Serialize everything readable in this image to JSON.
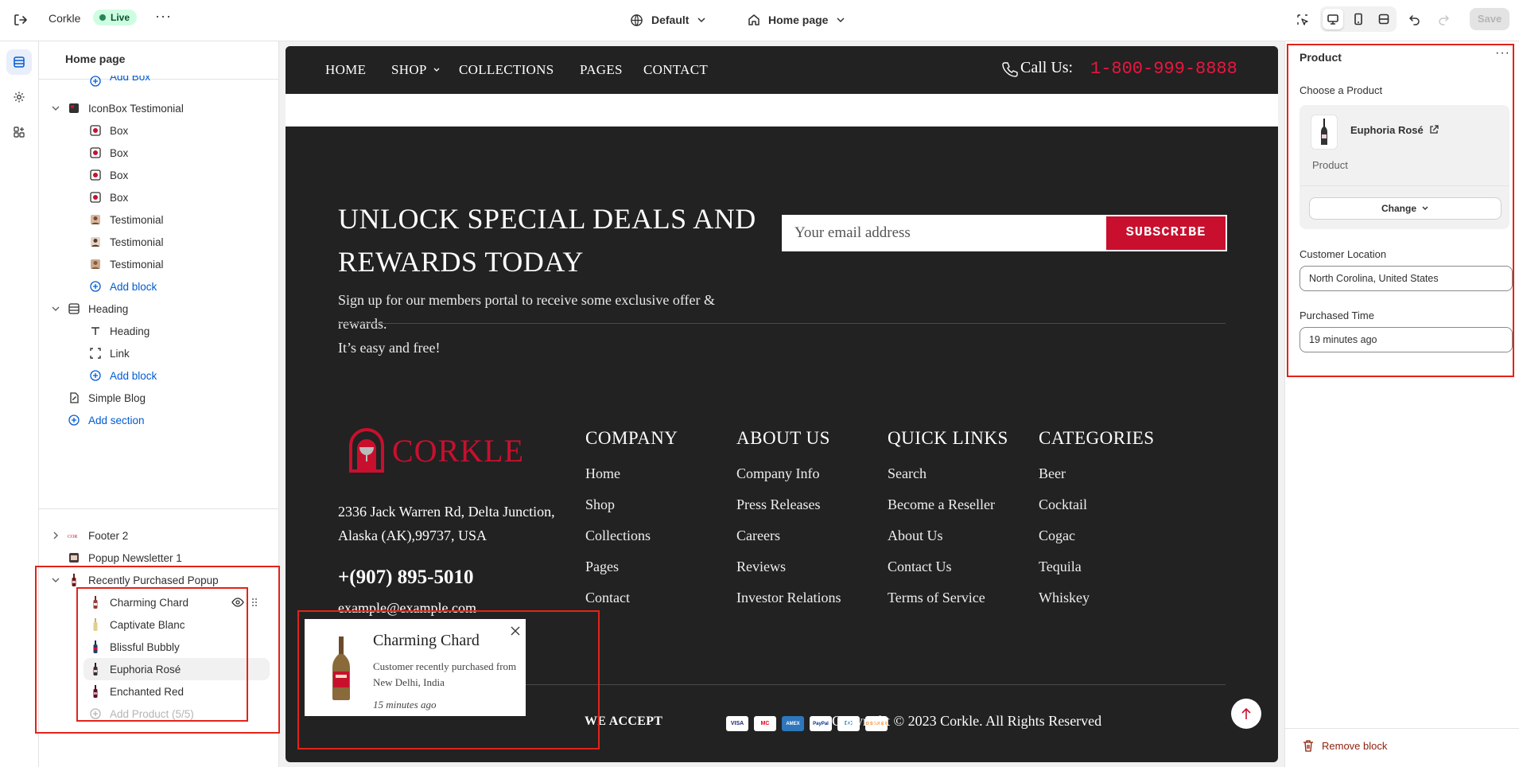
{
  "topbar": {
    "store_name": "Corkle",
    "status": "Live",
    "theme": "Default",
    "page": "Home page",
    "save_label": "Save"
  },
  "sidebar": {
    "title": "Home page",
    "items": [
      {
        "label": "Add Box",
        "type": "add"
      },
      {
        "label": "IconBox Testimonial",
        "type": "section"
      },
      {
        "label": "Box",
        "type": "block"
      },
      {
        "label": "Box",
        "type": "block"
      },
      {
        "label": "Box",
        "type": "block"
      },
      {
        "label": "Box",
        "type": "block"
      },
      {
        "label": "Testimonial",
        "type": "block"
      },
      {
        "label": "Testimonial",
        "type": "block"
      },
      {
        "label": "Testimonial",
        "type": "block"
      },
      {
        "label": "Add block",
        "type": "add"
      },
      {
        "label": "Heading",
        "type": "section"
      },
      {
        "label": "Heading",
        "type": "block"
      },
      {
        "label": "Link",
        "type": "block"
      },
      {
        "label": "Add block",
        "type": "add"
      },
      {
        "label": "Simple Blog",
        "type": "section"
      },
      {
        "label": "Add section",
        "type": "add"
      },
      {
        "label": "Footer 2",
        "type": "section"
      },
      {
        "label": "Popup Newsletter 1",
        "type": "section"
      },
      {
        "label": "Recently Purchased Popup",
        "type": "section"
      },
      {
        "label": "Charming Chard",
        "type": "block"
      },
      {
        "label": "Captivate Blanc",
        "type": "block"
      },
      {
        "label": "Blissful Bubbly",
        "type": "block"
      },
      {
        "label": "Euphoria Rosé",
        "type": "block"
      },
      {
        "label": "Enchanted Red",
        "type": "block"
      },
      {
        "label": "Add Product (5/5)",
        "type": "add-disabled"
      }
    ]
  },
  "store": {
    "nav": [
      "HOME",
      "SHOP",
      "COLLECTIONS",
      "PAGES",
      "CONTACT"
    ],
    "call_label": "Call Us:",
    "phone": "1-800-999-8888",
    "newsletter": {
      "heading": "UNLOCK SPECIAL DEALS AND REWARDS TODAY",
      "desc1": "Sign up for our members portal to receive some exclusive offer & rewards.",
      "desc2": "It’s easy and free!",
      "placeholder": "Your email address",
      "button": "SUBSCRIBE"
    },
    "logo_text": "CORKLE",
    "address": "2336 Jack Warren Rd, Delta Junction, Alaska (AK),99737, USA",
    "tel": "+(907) 895-5010",
    "email": "example@example.com",
    "columns": [
      {
        "title": "COMPANY",
        "links": [
          "Home",
          "Shop",
          "Collections",
          "Pages",
          "Contact"
        ]
      },
      {
        "title": "ABOUT US",
        "links": [
          "Company Info",
          "Press Releases",
          "Careers",
          "Reviews",
          "Investor Relations"
        ]
      },
      {
        "title": "QUICK LINKS",
        "links": [
          "Search",
          "Become a Reseller",
          "About Us",
          "Contact Us",
          "Terms of Service"
        ]
      },
      {
        "title": "CATEGORIES",
        "links": [
          "Beer",
          "Cocktail",
          "Cogac",
          "Tequila",
          "Whiskey"
        ]
      }
    ],
    "we_accept": "WE ACCEPT",
    "cards": [
      "VISA",
      "MC",
      "AMEX",
      "PayPal",
      "DC",
      "DISCOVER"
    ],
    "copyright": "Copyright © 2023 Corkle. All Rights Reserved",
    "popup": {
      "title": "Charming Chard",
      "desc": "Customer recently purchased from New Delhi, India",
      "time": "15 minutes ago"
    }
  },
  "panel": {
    "title": "Product",
    "choose_label": "Choose a Product",
    "product_name": "Euphoria Rosé",
    "product_type": "Product",
    "change_label": "Change",
    "location_label": "Customer Location",
    "location_value": "North Corolina, United States",
    "time_label": "Purchased Time",
    "time_value": "19 minutes ago",
    "remove_label": "Remove block"
  },
  "colors": {
    "accent": "#c8102e",
    "highlight": "#e2231a",
    "link": "#005bd3"
  }
}
